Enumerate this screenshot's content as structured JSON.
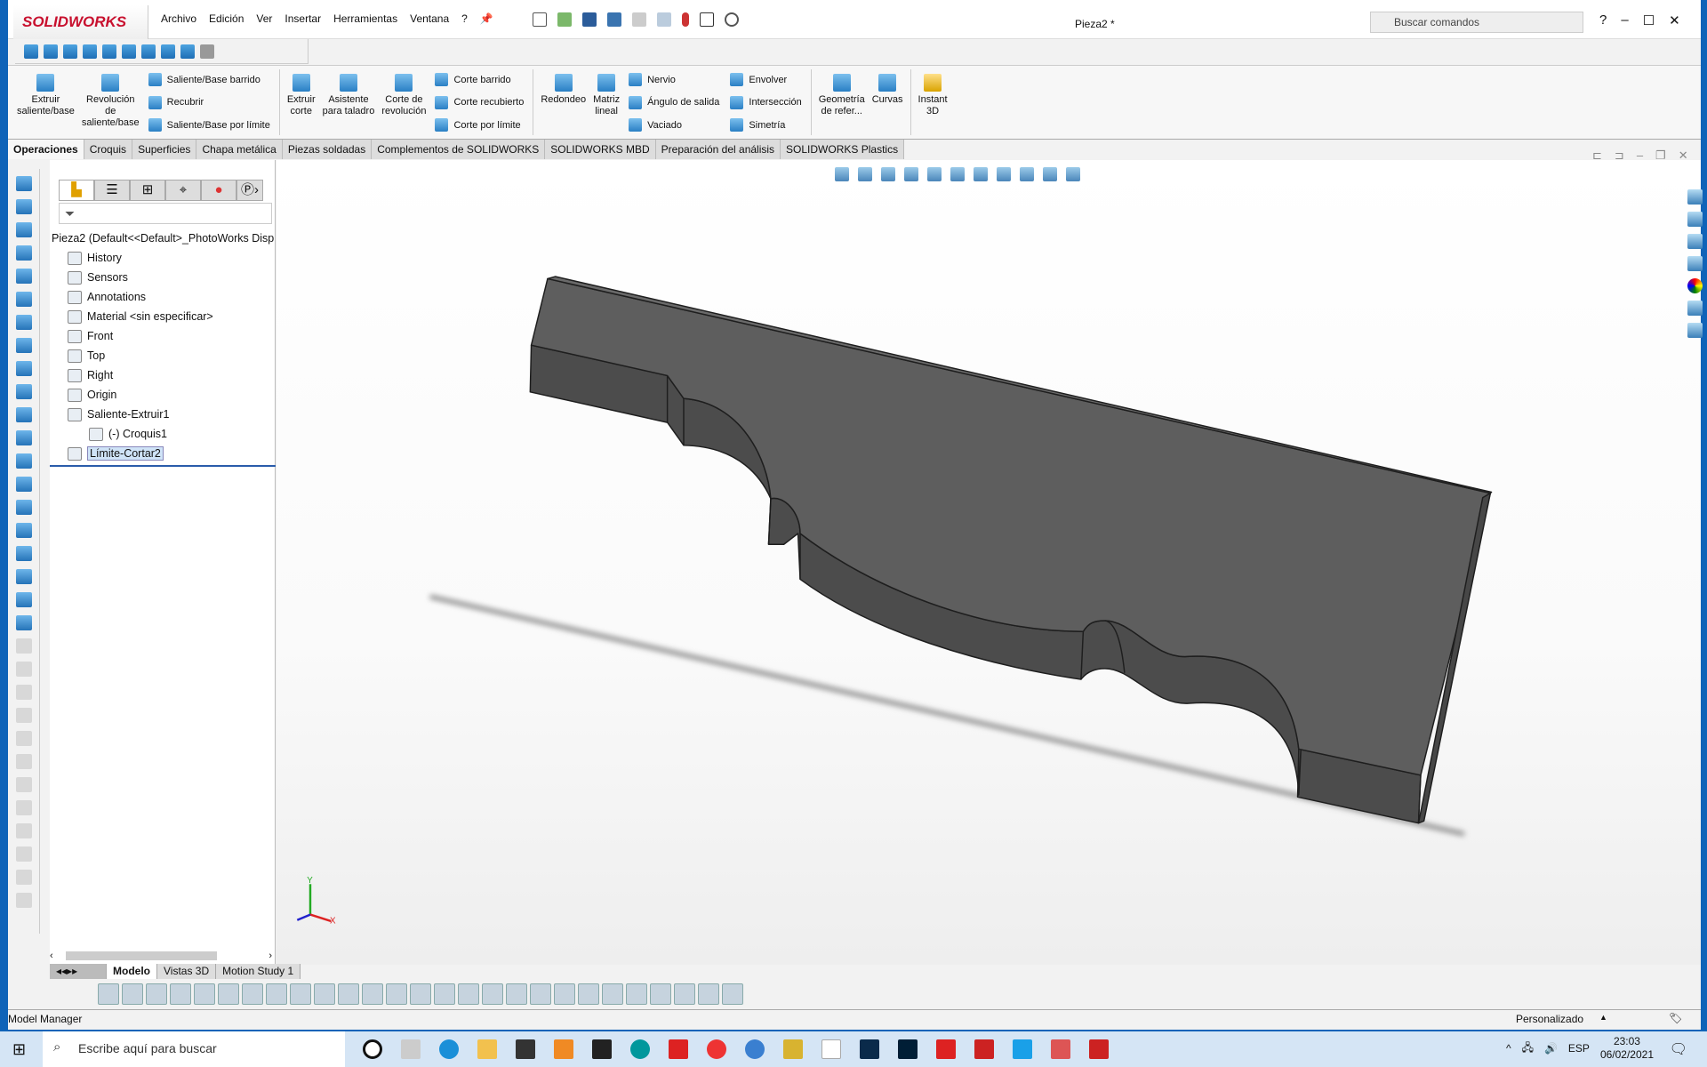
{
  "app": {
    "brand": "SOLIDWORKS",
    "document_title": "Pieza2 *",
    "search_placeholder": "Buscar comandos"
  },
  "menu": [
    "Archivo",
    "Edición",
    "Ver",
    "Insertar",
    "Herramientas",
    "Ventana",
    "?"
  ],
  "command_manager": {
    "extrude_boss": "Extruir\nsaliente/base",
    "revolve_boss": "Revolución\nde\nsaliente/base",
    "swept_boss": "Saliente/Base barrido",
    "loft": "Recubrir",
    "boundary_boss": "Saliente/Base por límite",
    "extrude_cut": "Extruir\ncorte",
    "hole_wizard": "Asistente\npara taladro",
    "revolve_cut": "Corte de\nrevolución",
    "swept_cut": "Corte barrido",
    "lofted_cut": "Corte recubierto",
    "boundary_cut": "Corte por límite",
    "fillet": "Redondeo",
    "linear_pattern": "Matriz\nlineal",
    "rib": "Nervio",
    "draft": "Ángulo de salida",
    "shell": "Vaciado",
    "wrap": "Envolver",
    "intersect": "Intersección",
    "mirror": "Simetría",
    "ref_geometry": "Geometría\nde refer...",
    "curves": "Curvas",
    "instant3d": "Instant\n3D"
  },
  "tabs": [
    "Operaciones",
    "Croquis",
    "Superficies",
    "Chapa metálica",
    "Piezas soldadas",
    "Complementos de SOLIDWORKS",
    "SOLIDWORKS MBD",
    "Preparación del análisis",
    "SOLIDWORKS Plastics"
  ],
  "tree": {
    "root": "Pieza2  (Default<<Default>_PhotoWorks Disp",
    "items": [
      {
        "label": "History",
        "icon": "history-folder-icon"
      },
      {
        "label": "Sensors",
        "icon": "sensors-folder-icon"
      },
      {
        "label": "Annotations",
        "icon": "annotations-folder-icon"
      },
      {
        "label": "Material <sin especificar>",
        "icon": "material-icon"
      },
      {
        "label": "Front",
        "icon": "plane-icon"
      },
      {
        "label": "Top",
        "icon": "plane-icon"
      },
      {
        "label": "Right",
        "icon": "plane-icon"
      },
      {
        "label": "Origin",
        "icon": "origin-icon"
      },
      {
        "label": "Saliente-Extruir1",
        "icon": "extrude-feature-icon"
      },
      {
        "label": "(-) Croquis1",
        "icon": "sketch-icon"
      },
      {
        "label": "Límite-Cortar2",
        "icon": "boundary-cut-feature-icon"
      }
    ]
  },
  "bottom_tabs": [
    "Modelo",
    "Vistas 3D",
    "Motion Study 1"
  ],
  "status": {
    "left": "Model Manager",
    "units": "Personalizado"
  },
  "taskbar": {
    "search": "Escribe aquí para buscar",
    "lang": "ESP",
    "time": "23:03",
    "date": "06/02/2021"
  },
  "triad": {
    "y": "Y",
    "x": "X"
  },
  "colors": {
    "part": "#5c5c5c",
    "brand": "#c8102e",
    "selection": "#cfe3f7"
  }
}
